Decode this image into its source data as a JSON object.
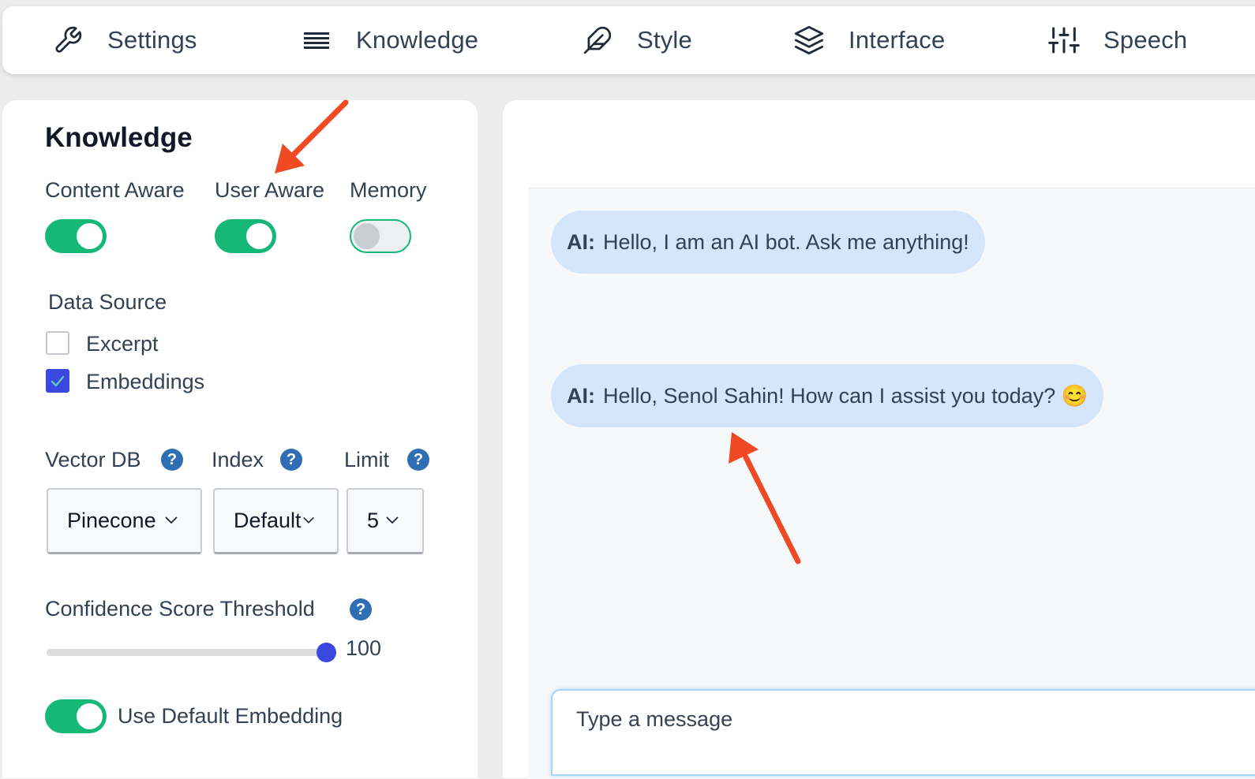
{
  "tabs": [
    {
      "label": "Settings",
      "icon": "wrench-icon"
    },
    {
      "label": "Knowledge",
      "icon": "list-icon"
    },
    {
      "label": "Style",
      "icon": "feather-icon"
    },
    {
      "label": "Interface",
      "icon": "layers-icon"
    },
    {
      "label": "Speech",
      "icon": "sliders-icon"
    }
  ],
  "knowledge": {
    "title": "Knowledge",
    "toggles": [
      {
        "label": "Content Aware",
        "on": true
      },
      {
        "label": "User Aware",
        "on": true
      },
      {
        "label": "Memory",
        "on": false
      }
    ],
    "data_source": {
      "label": "Data Source",
      "options": [
        {
          "label": "Excerpt",
          "checked": false
        },
        {
          "label": "Embeddings",
          "checked": true
        }
      ]
    },
    "vector_db": {
      "label": "Vector DB",
      "help": "?",
      "value": "Pinecone"
    },
    "index": {
      "label": "Index",
      "help": "?",
      "value": "Default"
    },
    "limit": {
      "label": "Limit",
      "help": "?",
      "value": "5"
    },
    "confidence": {
      "label": "Confidence Score Threshold",
      "help": "?",
      "value": "100"
    },
    "default_embedding": {
      "label": "Use Default Embedding",
      "on": true
    }
  },
  "chat": {
    "messages": [
      {
        "sender": "AI:",
        "text": "Hello, I am an AI bot. Ask me anything!"
      },
      {
        "sender": "AI:",
        "text": "Hello, Senol Sahin! How can I assist you today? 😊"
      }
    ],
    "input_placeholder": "Type a message"
  },
  "colors": {
    "accent_green": "#16b878",
    "accent_blue": "#3b48e0",
    "help_blue": "#2f6eb5",
    "bubble_bg": "#d5e6fa",
    "annotation_arrow": "#ef4a23"
  }
}
